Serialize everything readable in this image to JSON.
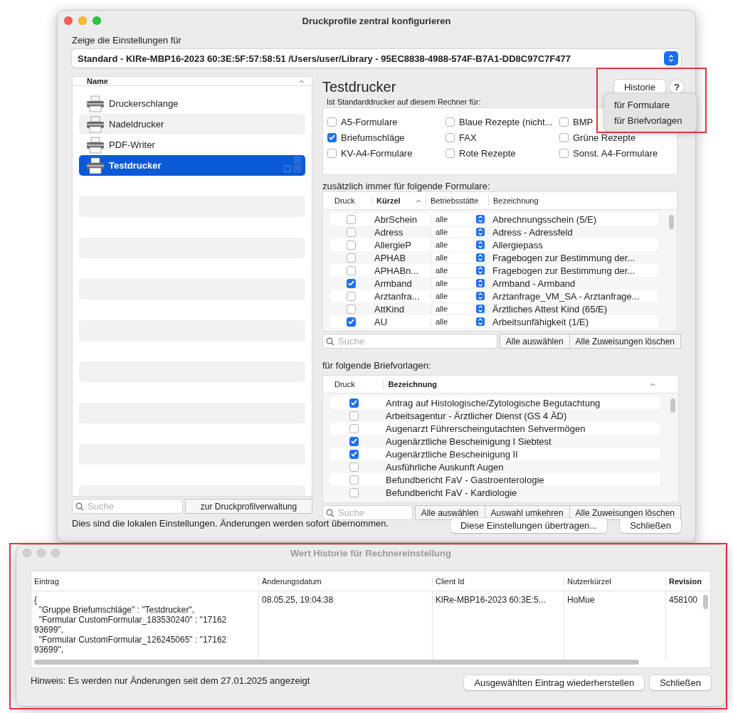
{
  "main_window": {
    "title": "Druckprofile zentral konfigurieren",
    "profile_label": "Zeige die Einstellungen für",
    "profile_value": "Standard - KlRe-MBP16-2023 60:3E:5F:57:58:51 /Users/user/Library - 95EC8838-4988-574F-B7A1-DD8C97C7F477",
    "printers": {
      "column": "Name",
      "items": [
        {
          "name": "Druckerschlange",
          "selected": false
        },
        {
          "name": "Nadeldrucker",
          "selected": false
        },
        {
          "name": "PDF-Writer",
          "selected": false
        },
        {
          "name": "Testdrucker",
          "selected": true
        }
      ],
      "search_placeholder": "Suche",
      "manage_button": "zur Druckprofilverwaltung"
    },
    "printer_title": "Testdrucker",
    "history_button": "Historie",
    "help_button": "?",
    "history_menu": [
      "für Formulare",
      "für Briefvorlagen"
    ],
    "default_label": "Ist Standarddrucker auf diesem Rechner für:",
    "default_for": [
      {
        "label": "A5-Formulare",
        "checked": false
      },
      {
        "label": "Blaue Rezepte (nicht...",
        "checked": false
      },
      {
        "label": "BMP",
        "checked": false
      },
      {
        "label": "Briefumschläge",
        "checked": true
      },
      {
        "label": "FAX",
        "checked": false
      },
      {
        "label": "Grüne Rezepte",
        "checked": false
      },
      {
        "label": "KV-A4-Formulare",
        "checked": false
      },
      {
        "label": "Rote Rezepte",
        "checked": false
      },
      {
        "label": "Sonst. A4-Formulare",
        "checked": false
      }
    ],
    "forms": {
      "label": "zusätzlich immer für folgende Formulare:",
      "columns": [
        {
          "label": "Druck",
          "sorted": false
        },
        {
          "label": "Kürzel",
          "sorted": true
        },
        {
          "label": "Betriebsstätte",
          "sorted": false
        },
        {
          "label": "Bezeichnung",
          "sorted": false
        }
      ],
      "rows": [
        {
          "checked": false,
          "code": "AbrSchein",
          "site": "alle",
          "name": "Abrechnungsschein (5/E)"
        },
        {
          "checked": false,
          "code": "Adress",
          "site": "alle",
          "name": "Adress - Adressfeld"
        },
        {
          "checked": false,
          "code": "AllergieP",
          "site": "alle",
          "name": "Allergiepass"
        },
        {
          "checked": false,
          "code": "APHAB",
          "site": "alle",
          "name": "Fragebogen zur Bestimmung der..."
        },
        {
          "checked": false,
          "code": "APHABn...",
          "site": "alle",
          "name": "Fragebogen zur Bestimmung der..."
        },
        {
          "checked": true,
          "code": "Armband",
          "site": "alle",
          "name": "Armband - Armband"
        },
        {
          "checked": false,
          "code": "Arztanfra...",
          "site": "alle",
          "name": "Arztanfrage_VM_SA - Arztanfrage..."
        },
        {
          "checked": false,
          "code": "AttKind",
          "site": "alle",
          "name": "Ärztliches Attest Kind (65/E)"
        },
        {
          "checked": true,
          "code": "AU",
          "site": "alle",
          "name": "Arbeitsunfähigkeit (1/E)"
        }
      ],
      "search_placeholder": "Suche",
      "buttons": [
        "Alle auswählen",
        "Alle Zuweisungen löschen"
      ]
    },
    "letters": {
      "label": "für folgende Briefvorlagen:",
      "columns": [
        {
          "label": "Druck",
          "sorted": false
        },
        {
          "label": "Bezeichnung",
          "sorted": true
        }
      ],
      "rows": [
        {
          "checked": true,
          "name": "Antrag auf Histologische/Zytologische Begutachtung"
        },
        {
          "checked": false,
          "name": "Arbeitsagentur - Ärztlicher Dienst (GS 4 ÄD)"
        },
        {
          "checked": false,
          "name": "Augenarzt Führerscheingutachten Sehvermögen"
        },
        {
          "checked": true,
          "name": "Augenärztliche Bescheinigung I Siebtest"
        },
        {
          "checked": true,
          "name": "Augenärztliche Bescheinigung II"
        },
        {
          "checked": false,
          "name": "Ausführliche Auskunft Augen"
        },
        {
          "checked": false,
          "name": "Befundbericht FaV - Gastroenterologie"
        },
        {
          "checked": false,
          "name": "Befundbericht FaV - Kardiologie"
        }
      ],
      "search_placeholder": "Suche",
      "buttons": [
        "Alle auswählen",
        "Auswahl umkehren",
        "Alle Zuweisungen löschen"
      ]
    },
    "footer_note": "Dies sind die lokalen Einstellungen. Änderungen werden sofort übernommen.",
    "buttons": [
      "Diese Einstellungen übertragen...",
      "Schließen"
    ]
  },
  "history_window": {
    "title": "Wert Historie für Rechnereinstellung",
    "columns": [
      {
        "label": "Eintrag",
        "sorted": false
      },
      {
        "label": "Änderungsdatum",
        "sorted": false
      },
      {
        "label": "Client Id",
        "sorted": false
      },
      {
        "label": "Nutzerkürzel",
        "sorted": false
      },
      {
        "label": "Revision",
        "sorted": true
      }
    ],
    "rows": [
      {
        "entry": [
          "{",
          "  \"Gruppe Briefumschläge\" : \"Testdrucker\",",
          "  \"Formular CustomFormular_183530240\" : \"17162",
          "93699\",",
          "  \"Formular CustomFormular_126245065\" : \"17162",
          "93699\","
        ],
        "date": "08.05.25, 19:04:38",
        "client": "KlRe-MBP16-2023 60:3E:5...",
        "user": "HoMue",
        "revision": "458100"
      }
    ],
    "hint": "Hinweis: Es werden nur Änderungen seit dem 27.01.2025 angezeigt",
    "buttons": [
      "Ausgewählten Eintrag wiederherstellen",
      "Schließen"
    ]
  }
}
